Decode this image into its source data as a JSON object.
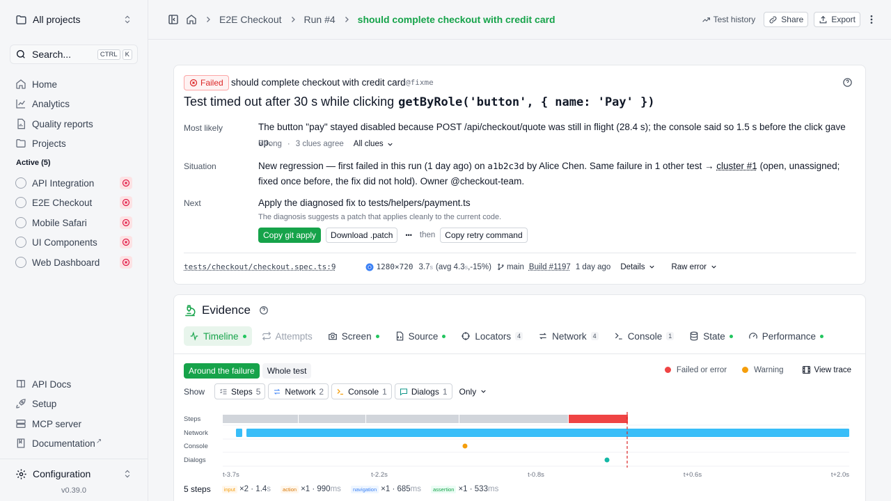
{
  "sidebar": {
    "project_selector": "All projects",
    "search": {
      "label": "Search...",
      "kbd1": "CTRL",
      "kbd2": "K"
    },
    "nav": [
      {
        "label": "Home",
        "icon": "home-icon"
      },
      {
        "label": "Analytics",
        "icon": "chart-icon"
      },
      {
        "label": "Quality reports",
        "icon": "report-icon"
      },
      {
        "label": "Projects",
        "icon": "folder-icon"
      }
    ],
    "active_heading": "Active (5)",
    "projects": [
      "API Integration",
      "E2E Checkout",
      "Mobile Safari",
      "UI Components",
      "Web Dashboard"
    ],
    "footer_nav": [
      {
        "label": "API Docs",
        "icon": "book-icon"
      },
      {
        "label": "Setup",
        "icon": "rocket-icon"
      },
      {
        "label": "MCP server",
        "icon": "server-icon"
      },
      {
        "label": "Documentation",
        "icon": "bookmark-icon",
        "external": "↗"
      }
    ],
    "configuration": "Configuration",
    "version": "v0.39.0"
  },
  "topbar": {
    "breadcrumbs": [
      "E2E Checkout",
      "Run #4",
      "should complete checkout with credit card"
    ],
    "test_history": "Test history",
    "share": "Share",
    "export": "Export"
  },
  "failure": {
    "status": "Failed",
    "test_name": "should complete checkout with credit card",
    "tag": "@fixme",
    "headline_prefix": "Test timed out after 30 s while clicking",
    "headline_code": "getByRole('button', { name: 'Pay' })",
    "most_likely_label": "Most likely",
    "most_likely_text": "The button \"pay\" stayed disabled because POST /api/checkout/quote was still in flight (28.4 s); the console said so 1.5 s before the click gave up.",
    "strength": "Strong",
    "sep": "·",
    "clues_agree": "3 clues agree",
    "all_clues": "All clues",
    "situation_label": "Situation",
    "situation_a": "New regression — first failed in this run (1 day ago) on",
    "situation_commit": "a1b2c3d",
    "situation_b": "by Alice Chen. Same failure in 1 other test →",
    "situation_cluster": "cluster #1",
    "situation_c": "(open, unassigned; fixed once before, the fix did not hold). Owner @checkout-team.",
    "next_label": "Next",
    "next_text": "Apply the diagnosed fix to tests/helpers/payment.ts",
    "next_sub": "The diagnosis suggests a patch that applies cleanly to the current code.",
    "copy_git_apply": "Copy git apply",
    "download_patch": "Download .patch",
    "more": "•••",
    "then": "then",
    "copy_retry": "Copy retry command",
    "meta": {
      "file": "tests/checkout/checkout.spec.ts:9",
      "viewport": "1280×720",
      "duration": "3.7",
      "duration_unit": "s",
      "avg": "(avg 4.3",
      "avg_unit": "s",
      "avg_delta": ",-15%)",
      "branch": "main",
      "build": "Build #1197",
      "ago": "1 day ago",
      "details": "Details",
      "raw_error": "Raw error"
    }
  },
  "evidence": {
    "title": "Evidence",
    "tabs": [
      {
        "label": "Timeline",
        "icon": "pulse-icon",
        "dot": true
      },
      {
        "label": "Attempts",
        "icon": "repeat-icon",
        "dot": false
      },
      {
        "label": "Screen",
        "icon": "camera-icon",
        "dot": true
      },
      {
        "label": "Source",
        "icon": "file-code-icon",
        "dot": true
      },
      {
        "label": "Locators",
        "icon": "target-icon",
        "count": "4"
      },
      {
        "label": "Network",
        "icon": "arrows-icon",
        "count": "4"
      },
      {
        "label": "Console",
        "icon": "terminal-icon",
        "count": "1"
      },
      {
        "label": "State",
        "icon": "database-icon",
        "dot": true
      },
      {
        "label": "Performance",
        "icon": "gauge-icon",
        "dot": true
      }
    ],
    "around_failure": "Around the failure",
    "whole_test": "Whole test",
    "legend_failed": "Failed or error",
    "legend_warning": "Warning",
    "view_trace": "View trace",
    "show": "Show",
    "filters": [
      {
        "label": "Steps",
        "count": "5"
      },
      {
        "label": "Network",
        "count": "2"
      },
      {
        "label": "Console",
        "count": "1"
      },
      {
        "label": "Dialogs",
        "count": "1"
      }
    ],
    "only": "Only",
    "timeline": {
      "rows": [
        "Steps",
        "Network",
        "Console",
        "Dialogs"
      ],
      "ticks": [
        "t-3.7s",
        "t-2.2s",
        "t-0.8s",
        "t+0.6s",
        "t+2.0s"
      ]
    },
    "steps_summary": {
      "count": "5 steps",
      "items": [
        {
          "kind": "input",
          "mult": "×2 · 1.4",
          "unit": "s"
        },
        {
          "kind": "action",
          "mult": "×1 · 990",
          "unit": "ms"
        },
        {
          "kind": "navigation",
          "mult": "×1 · 685",
          "unit": "ms"
        },
        {
          "kind": "assertion",
          "mult": "×1 · 533",
          "unit": "ms"
        }
      ]
    }
  },
  "colors": {
    "accent": "#16a34a",
    "failed": "#ef4444",
    "warning": "#f59e0b",
    "network": "#38bdf8",
    "step": "#d1d5db"
  }
}
